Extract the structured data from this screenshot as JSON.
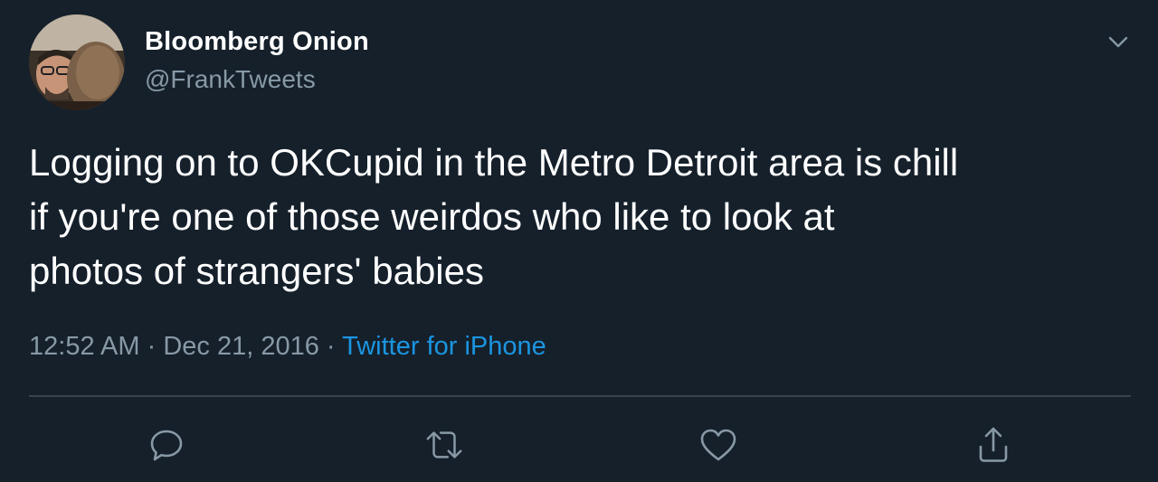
{
  "tweet": {
    "author_name": "Bloomberg Onion",
    "handle": "@FrankTweets",
    "text": "Logging on to OKCupid in the Metro Detroit area is chill\nif you're one of those weirdos who like to look at\nphotos of strangers' babies",
    "time": "12:52 AM",
    "separator": "·",
    "date": "Dec 21, 2016",
    "source": "Twitter for iPhone"
  },
  "icons": {
    "menu": "chevron-down-icon",
    "reply": "reply-icon",
    "retweet": "retweet-icon",
    "like": "heart-icon",
    "share": "share-icon"
  },
  "colors": {
    "background": "#15202b",
    "secondary_text": "#8899a6",
    "link": "#1b95e0",
    "divider": "#38444d"
  }
}
